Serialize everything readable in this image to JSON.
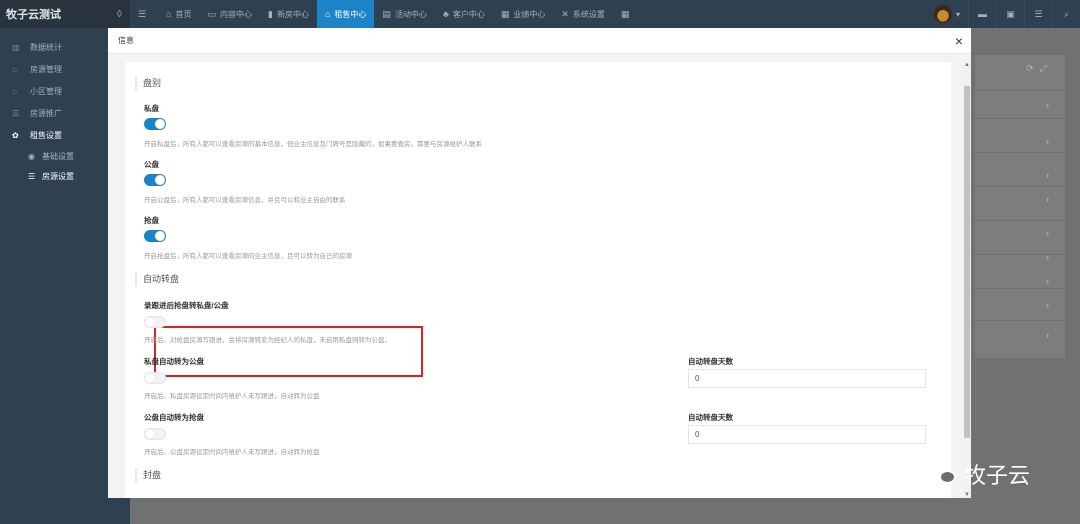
{
  "app": {
    "brand": "牧子云测试",
    "brand_icon": "water-drop-icon"
  },
  "topnav": {
    "items": [
      {
        "icon": "menu-icon",
        "glyph": "☰",
        "label": ""
      },
      {
        "icon": "home-icon",
        "glyph": "⌂",
        "label": "首页"
      },
      {
        "icon": "content-icon",
        "glyph": "▭",
        "label": "内容中心"
      },
      {
        "icon": "house-icon",
        "glyph": "▮",
        "label": "新房中心"
      },
      {
        "icon": "rent-icon",
        "glyph": "⌂",
        "label": "租售中心",
        "active": true
      },
      {
        "icon": "activity-icon",
        "glyph": "▤",
        "label": "活动中心"
      },
      {
        "icon": "customer-icon",
        "glyph": "♣",
        "label": "客户中心"
      },
      {
        "icon": "performance-icon",
        "glyph": "▦",
        "label": "业绩中心"
      },
      {
        "icon": "settings-icon",
        "glyph": "✕",
        "label": "系统设置"
      },
      {
        "icon": "grid-icon",
        "glyph": "▦",
        "label": ""
      }
    ],
    "right_tools": [
      {
        "icon": "trash-icon",
        "glyph": "▬"
      },
      {
        "icon": "fullscreen-icon",
        "glyph": "▣"
      },
      {
        "icon": "list-icon",
        "glyph": "☰"
      },
      {
        "icon": "search-icon",
        "glyph": "⌕"
      }
    ],
    "user_caret": "▾"
  },
  "sidebar": {
    "items": [
      {
        "icon": "chart-icon",
        "glyph": "▥",
        "label": "数据统计"
      },
      {
        "icon": "house-icon",
        "glyph": "⌂",
        "label": "房源管理"
      },
      {
        "icon": "community-icon",
        "glyph": "⌂",
        "label": "小区管理"
      },
      {
        "icon": "promotion-icon",
        "glyph": "☰",
        "label": "房源推广"
      },
      {
        "icon": "gear-icon",
        "glyph": "✿",
        "label": "租售设置",
        "open": true
      }
    ],
    "subitems": [
      {
        "icon": "circle-icon",
        "glyph": "◉",
        "label": "基础设置"
      },
      {
        "icon": "list-icon",
        "glyph": "☰",
        "label": "房源设置",
        "active": true
      }
    ]
  },
  "modal": {
    "title": "信息",
    "close": "×",
    "sections": {
      "pan_type": "盘别",
      "auto_transfer": "自动转盘",
      "seal": "封盘"
    },
    "private": {
      "label": "私盘",
      "on": true,
      "help": "开启私盘后，所有人都可以查看房源的基本信息，但业主信息及门牌号是隐藏的，如果要查房，需要与房源维护人联系"
    },
    "public": {
      "label": "公盘",
      "on": true,
      "help": "开启公盘后，所有人都可以查看房源信息，并且可以和业主自由的联系"
    },
    "grab": {
      "label": "抢盘",
      "on": true,
      "help": "开启抢盘后，所有人都可以查看房源的业主信息，且可以转为自己的房源"
    },
    "followup": {
      "label": "录跟进后抢盘转私盘/公盘",
      "on": false,
      "help": "开启后，对抢盘房源写跟进，会将房源转变为经纪人的私盘，未启用私盘则转为公盘。"
    },
    "private_auto": {
      "label": "私盘自动转为公盘",
      "on": false,
      "help": "开启后，私盘房源设定时间内维护人未写跟进，自动转为公盘"
    },
    "public_auto": {
      "label": "公盘自动转为抢盘",
      "on": false,
      "help": "开启后，公盘房源设定时间内维护人未写跟进，自动转为抢盘"
    },
    "days1": {
      "label": "自动转盘天数",
      "value": "0"
    },
    "days2": {
      "label": "自动转盘天数",
      "value": "0"
    }
  },
  "watermark": {
    "text": "牧子云"
  }
}
